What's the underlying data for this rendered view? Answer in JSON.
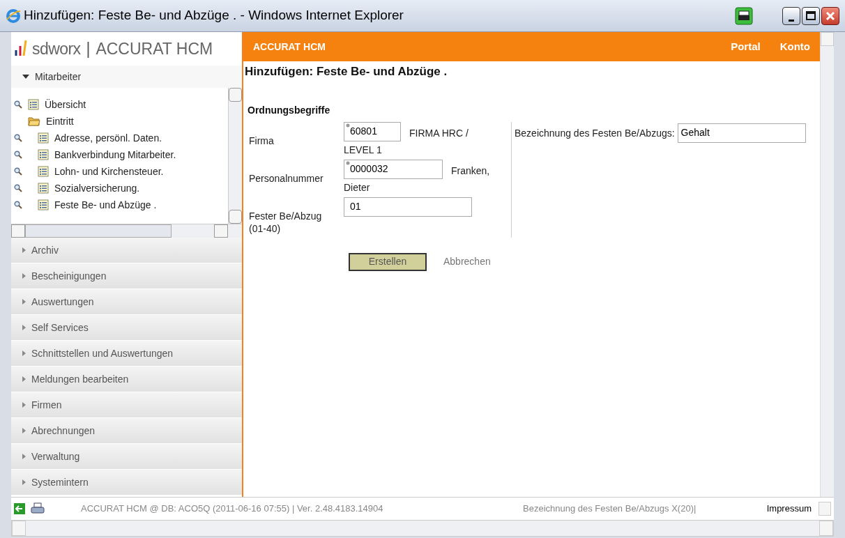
{
  "window": {
    "title": "Hinzufügen: Feste Be- und Abzüge . - Windows Internet Explorer"
  },
  "logo": {
    "brand": "sdworx",
    "separator": "|",
    "product": "ACCURAT HCM"
  },
  "nav_panel": {
    "title": "Mitarbeiter",
    "expanded": true,
    "tree": [
      {
        "label": "Übersicht",
        "kind": "page"
      },
      {
        "label": "Eintritt",
        "kind": "folder",
        "children": [
          {
            "label": "Adresse, persönl. Daten.",
            "kind": "page"
          },
          {
            "label": "Bankverbindung Mitarbeiter.",
            "kind": "page"
          },
          {
            "label": "Lohn- und Kirchensteuer.",
            "kind": "page"
          },
          {
            "label": "Sozialversicherung.",
            "kind": "page"
          },
          {
            "label": "Feste Be- und Abzüge .",
            "kind": "page"
          }
        ]
      }
    ]
  },
  "sections": [
    {
      "label": "Archiv",
      "expanded": false
    },
    {
      "label": "Bescheinigungen",
      "expanded": false
    },
    {
      "label": "Auswertungen",
      "expanded": false
    },
    {
      "label": "Self Services",
      "expanded": false
    },
    {
      "label": "Schnittstellen und Auswertungen",
      "expanded": false
    },
    {
      "label": "Meldungen bearbeiten",
      "expanded": false
    },
    {
      "label": "Firmen",
      "expanded": false
    },
    {
      "label": "Abrechnungen",
      "expanded": false
    },
    {
      "label": "Verwaltung",
      "expanded": false
    },
    {
      "label": "Systemintern",
      "expanded": false
    }
  ],
  "header": {
    "app_name": "ACCURAT HCM",
    "links": [
      "Portal",
      "Konto"
    ]
  },
  "page_title": "Hinzufügen: Feste Be- und Abzüge .",
  "form": {
    "section_title": "Ordnungsbegriffe",
    "fields": [
      {
        "label": "Firma",
        "value": "60801",
        "lookup": true,
        "description": [
          "FIRMA HRC /",
          "LEVEL 1"
        ]
      },
      {
        "label": "Personalnummer",
        "value": "0000032",
        "lookup": true,
        "description": [
          "Franken,",
          "Dieter"
        ]
      },
      {
        "label": "Fester Be/Abzug (01-40)",
        "value": "01",
        "lookup": false
      }
    ],
    "right_field": {
      "label": "Bezeichnung des Festen Be/Abzugs:",
      "value": "Gehalt"
    },
    "submit": "Erstellen",
    "cancel": "Abbrechen"
  },
  "status_bar": {
    "info": "ACCURAT HCM @ DB: ACO5Q (2011-06-16 07:55) | Ver. 2.48.4183.14904",
    "hint": "Bezeichnung des Festen Be/Abzugs X(20)|",
    "link": "Impressum"
  }
}
